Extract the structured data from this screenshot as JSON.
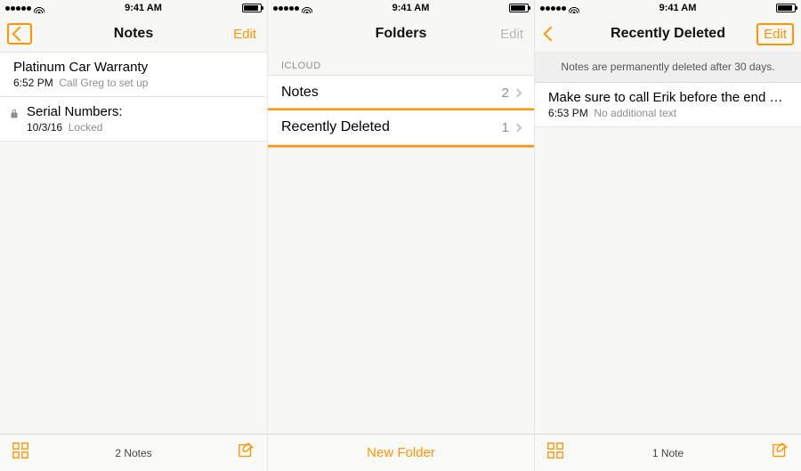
{
  "status": {
    "time": "9:41 AM"
  },
  "screen1": {
    "title": "Notes",
    "edit": "Edit",
    "notes": [
      {
        "title": "Platinum Car Warranty",
        "time": "6:52 PM",
        "preview": "Call Greg to set up",
        "locked": false
      },
      {
        "title": "Serial Numbers:",
        "time": "10/3/16",
        "preview": "Locked",
        "locked": true
      }
    ],
    "footer_count": "2 Notes"
  },
  "screen2": {
    "title": "Folders",
    "edit": "Edit",
    "section": "ICLOUD",
    "folders": [
      {
        "name": "Notes",
        "count": "2"
      },
      {
        "name": "Recently Deleted",
        "count": "1"
      }
    ],
    "new_folder": "New Folder"
  },
  "screen3": {
    "title": "Recently Deleted",
    "edit": "Edit",
    "info": "Notes are permanently deleted after 30 days.",
    "notes": [
      {
        "title": "Make sure to call Erik before the end of the n...",
        "time": "6:53 PM",
        "preview": "No additional text"
      }
    ],
    "footer_count": "1 Note"
  }
}
